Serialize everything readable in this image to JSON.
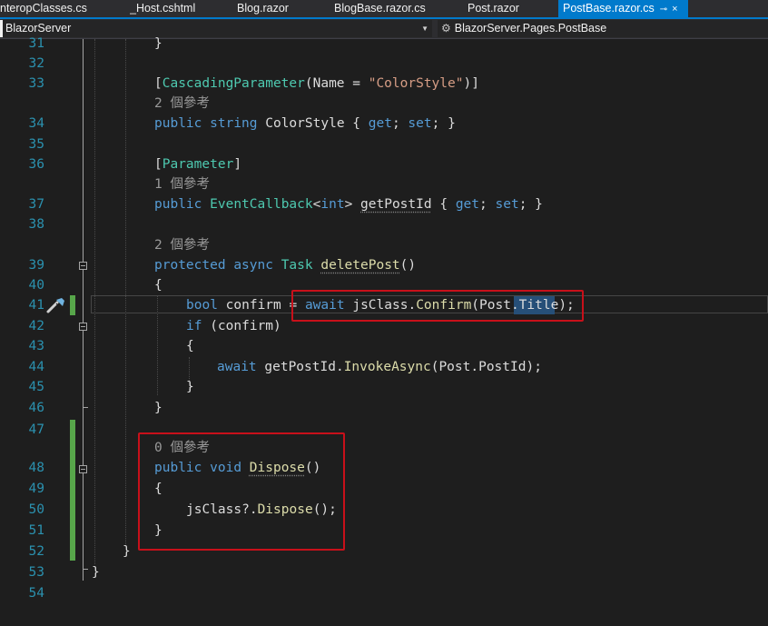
{
  "tabs": [
    {
      "label": "nteropClasses.cs",
      "active": false
    },
    {
      "label": "_Host.cshtml",
      "active": false
    },
    {
      "label": "Blog.razor",
      "active": false
    },
    {
      "label": "BlogBase.razor.cs",
      "active": false
    },
    {
      "label": "Post.razor",
      "active": false
    },
    {
      "label": "PostBase.razor.cs",
      "active": true,
      "pin": "⊸",
      "close": "×"
    }
  ],
  "navbar": {
    "project": "BlazorServer",
    "class": "BlazorServer.Pages.PostBase"
  },
  "editor": {
    "current_line": 41,
    "selected_text": "Title",
    "line_numbers": [
      "31",
      "32",
      "33",
      "34",
      "35",
      "36",
      "37",
      "38",
      "39",
      "40",
      "41",
      "42",
      "43",
      "44",
      "45",
      "46",
      "47",
      "48",
      "49",
      "50",
      "51",
      "52",
      "53",
      "54"
    ],
    "code_lens": [
      "2 個參考",
      "1 個參考",
      "2 個參考",
      "0 個參考"
    ],
    "lines": {
      "l31": "}",
      "l33": "[CascadingParameter(Name = \"ColorStyle\")]",
      "l34": "public string ColorStyle { get; set; }",
      "l36": "[Parameter]",
      "l37": "public EventCallback<int> getPostId { get; set; }",
      "l39": "protected async Task deletePost()",
      "l40": "{",
      "l41": "bool confirm = await jsClass.Confirm(Post.Title);",
      "l42": "if (confirm)",
      "l43": "{",
      "l44": "await getPostId.InvokeAsync(Post.PostId);",
      "l45": "}",
      "l46": "}",
      "l48": "public void Dispose()",
      "l49": "{",
      "l50": "jsClass?.Dispose();",
      "l51": "}",
      "l52": "}",
      "l53": "}"
    }
  },
  "colors": {
    "keyword": "#569cd6",
    "type": "#4ec9b0",
    "method": "#dcdcaa",
    "string": "#d69d85",
    "line_number": "#2b91af",
    "highlight_box": "#c8101a",
    "tab_active": "#007acc"
  }
}
